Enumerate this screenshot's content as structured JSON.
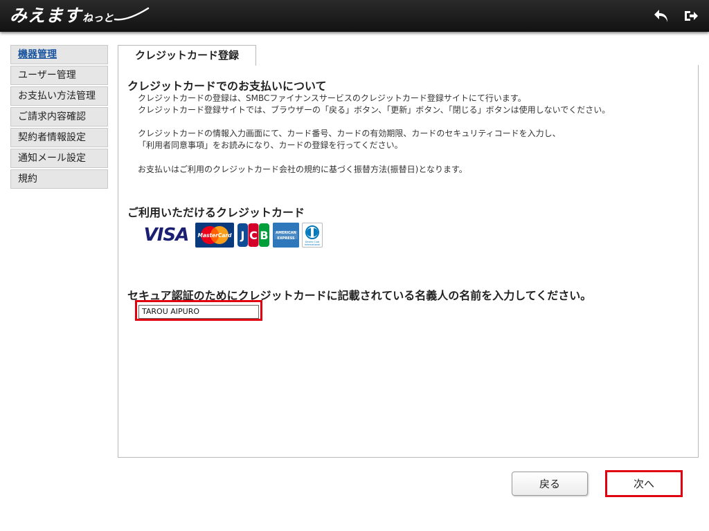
{
  "header": {
    "logo_main": "みえます",
    "logo_sub": "ねっと",
    "back_icon": "back-arrow-icon",
    "logout_icon": "logout-icon"
  },
  "sidebar": {
    "items": [
      {
        "label": "機器管理",
        "active": true
      },
      {
        "label": "ユーザー管理"
      },
      {
        "label": "お支払い方法管理"
      },
      {
        "label": "ご請求内容確認"
      },
      {
        "label": "契約者情報設定"
      },
      {
        "label": "通知メール設定"
      },
      {
        "label": "規約"
      }
    ]
  },
  "tab": {
    "label": "クレジットカード登録"
  },
  "section1": {
    "title": "クレジットカードでのお支払いについて",
    "lines": [
      "クレジットカードの登録は、SMBCファイナンスサービスのクレジットカード登録サイトにて行います。",
      "クレジットカード登録サイトでは、ブラウザーの「戻る」ボタン、「更新」ボタン、「閉じる」ボタンは使用しないでください。",
      "クレジットカードの情報入力画面にて、カード番号、カードの有効期限、カードのセキュリティコードを入力し、",
      "「利用者同意事項」をお読みになり、カードの登録を行ってください。",
      "お支払いはご利用のクレジットカード会社の規約に基づく振替方法(振替日)となります。"
    ]
  },
  "section2": {
    "title": "ご利用いただけるクレジットカード",
    "cards": {
      "visa": "VISA",
      "mastercard": "MasterCard",
      "jcb": "JCB",
      "amex": "AMERICAN EXPRESS",
      "diners": "Diners Club International"
    }
  },
  "section3": {
    "title": "セキュア認証のためにクレジットカードに記載されている名義人の名前を入力してください。",
    "input_value": "TAROU AIPURO"
  },
  "buttons": {
    "back": "戻る",
    "next": "次へ"
  },
  "colors": {
    "header_bg": "#1c1c1c",
    "highlight_red": "#e10010",
    "active_link": "#1a55a0"
  }
}
